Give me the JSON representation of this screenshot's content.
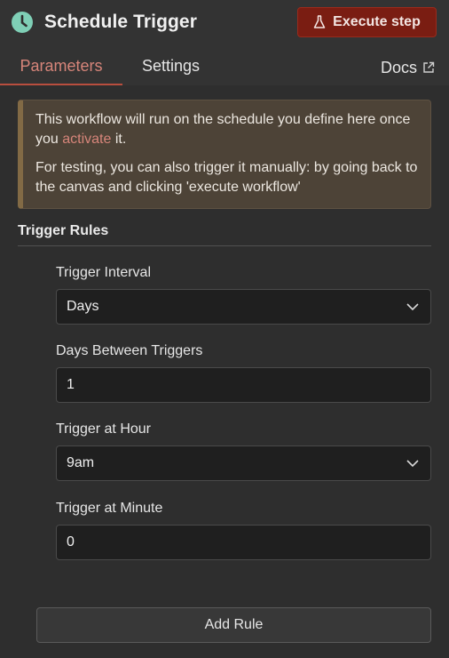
{
  "header": {
    "icon": "clock-icon",
    "title": "Schedule Trigger",
    "execute_button": {
      "label": "Execute step",
      "icon": "flask-icon",
      "color": "#7a1d12"
    }
  },
  "tabs": {
    "parameters": "Parameters",
    "settings": "Settings",
    "docs": "Docs",
    "docs_icon": "external-link-icon",
    "active": "parameters",
    "accent_color": "#d7857a"
  },
  "notice": {
    "line1_before": "This workflow will run on the schedule you define here once you ",
    "link": "activate",
    "line1_after": " it.",
    "line2": "For testing, you can also trigger it manually: by going back to the canvas and clicking 'execute workflow'"
  },
  "trigger_rules": {
    "title": "Trigger Rules",
    "interval": {
      "label": "Trigger Interval",
      "value": "Days"
    },
    "days_between": {
      "label": "Days Between Triggers",
      "value": "1"
    },
    "hour": {
      "label": "Trigger at Hour",
      "value": "9am"
    },
    "minute": {
      "label": "Trigger at Minute",
      "value": "0"
    },
    "add_rule": "Add Rule"
  }
}
